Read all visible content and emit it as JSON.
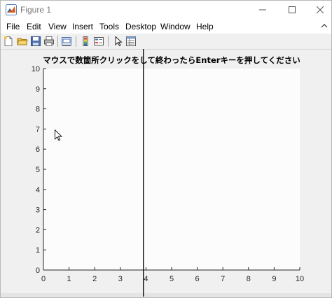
{
  "window": {
    "title": "Figure 1"
  },
  "menu": {
    "items": [
      "File",
      "Edit",
      "View",
      "Insert",
      "Tools",
      "Desktop",
      "Window",
      "Help"
    ]
  },
  "toolbar": {
    "buttons": [
      {
        "name": "new-figure",
        "icon": "new-file-icon"
      },
      {
        "name": "open-file",
        "icon": "folder-icon"
      },
      {
        "name": "save-figure",
        "icon": "save-icon"
      },
      {
        "name": "print-figure",
        "icon": "printer-icon"
      },
      {
        "name": "link-plot",
        "icon": "link-plot-icon"
      },
      {
        "name": "insert-colorbar",
        "icon": "colorbar-icon"
      },
      {
        "name": "insert-legend",
        "icon": "legend-icon"
      },
      {
        "name": "edit-plot",
        "icon": "arrow-cursor-icon"
      },
      {
        "name": "property-inspector",
        "icon": "property-inspector-icon"
      }
    ]
  },
  "colors": {
    "axes_background": "#fcfcfc",
    "figure_background": "#f0f0f0",
    "axis_color": "#262626",
    "crosshair_color": "#000000"
  },
  "chart_data": {
    "type": "scatter",
    "title": "マウスで数箇所クリックをして終わったらEnterキーを押してください",
    "xlabel": "",
    "ylabel": "",
    "xlim": [
      0,
      10
    ],
    "ylim": [
      0,
      10
    ],
    "xticks": [
      0,
      1,
      2,
      3,
      4,
      5,
      6,
      7,
      8,
      9,
      10
    ],
    "yticks": [
      0,
      1,
      2,
      3,
      4,
      5,
      6,
      7,
      8,
      9,
      10
    ],
    "grid": false,
    "series": [],
    "crosshair_x": 3.9,
    "pointer": {
      "x": 0.45,
      "y": 6.95
    }
  }
}
